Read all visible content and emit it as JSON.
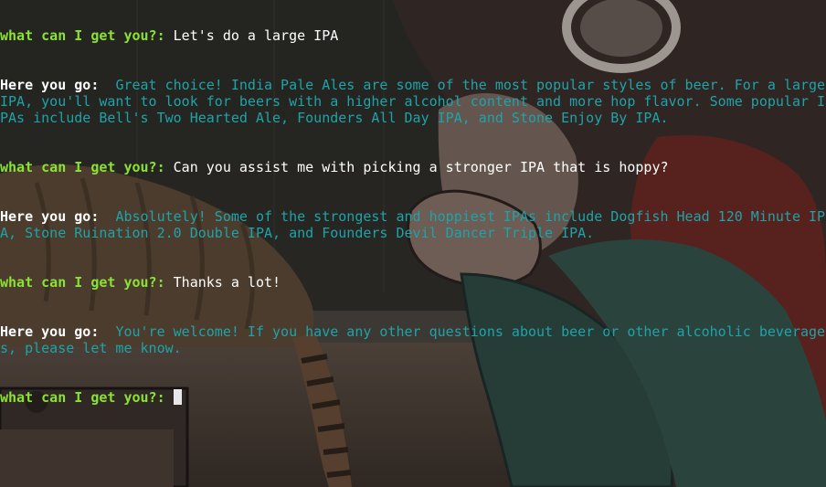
{
  "terminal": {
    "prompt_label": "what can I get you?:",
    "reply_label": "Here you go:",
    "colors": {
      "prompt": "#8ae234",
      "reply_label": "#ffffff",
      "user_text": "#ffffff",
      "bot_text": "#1fa3a8",
      "background": "#2a2b27"
    },
    "lines": [
      {
        "kind": "user",
        "text": "Let's do a large IPA"
      },
      {
        "kind": "bot",
        "text": "Great choice! India Pale Ales are some of the most popular styles of beer. For a large IPA, you'll want to look for beers with a higher alcohol content and more hop flavor. Some popular IPAs include Bell's Two Hearted Ale, Founders All Day IPA, and Stone Enjoy By IPA."
      },
      {
        "kind": "user",
        "text": "Can you assist me with picking a stronger IPA that is hoppy?"
      },
      {
        "kind": "bot",
        "text": "Absolutely! Some of the strongest and hoppiest IPAs include Dogfish Head 120 Minute IPA, Stone Ruination 2.0 Double IPA, and Founders Devil Dancer Triple IPA."
      },
      {
        "kind": "user",
        "text": "Thanks a lot!"
      },
      {
        "kind": "bot",
        "text": "You're welcome! If you have any other questions about beer or other alcoholic beverages, please let me know."
      }
    ],
    "current_input": ""
  }
}
